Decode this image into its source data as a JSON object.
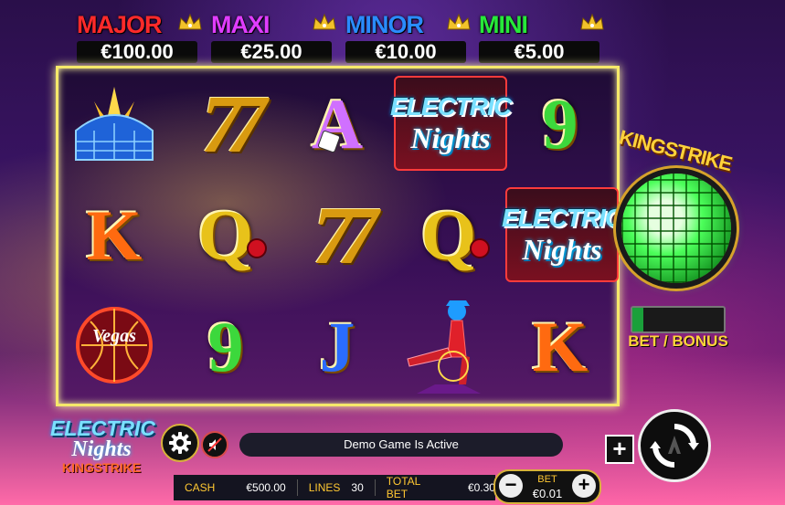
{
  "jackpots": [
    {
      "name": "MAJOR",
      "value": "€100.00",
      "color": "#ff2a2a"
    },
    {
      "name": "MAXI",
      "value": "€25.00",
      "color": "#e03cff"
    },
    {
      "name": "MINOR",
      "value": "€10.00",
      "color": "#2a8cff"
    },
    {
      "name": "MINI",
      "value": "€5.00",
      "color": "#27e93a"
    }
  ],
  "reels": {
    "wild_line1": "ELECTRIC",
    "wild_line2": "Nights",
    "symbols": {
      "ace": "A",
      "king": "K",
      "queen": "Q",
      "jack": "J",
      "nine": "9",
      "seven": "77"
    },
    "vegas_text": "Vegas"
  },
  "side": {
    "brand": "KINGSTRIKE",
    "bet_bonus": "BET / BONUS",
    "bonus_fill": 0.12
  },
  "bottom": {
    "logo_line1": "ELECTRIC",
    "logo_line2": "Nights",
    "logo_line3": "KINGSTRIKE",
    "message": "Demo Game Is Active",
    "cash_label": "CASH",
    "cash_value": "€500.00",
    "lines_label": "LINES",
    "lines_value": "30",
    "total_bet_label": "TOTAL BET",
    "total_bet_value": "€0.30",
    "bet_label": "BET",
    "bet_value": "€0.01",
    "minus": "−",
    "plus": "+"
  }
}
